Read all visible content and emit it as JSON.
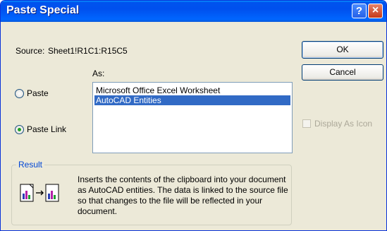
{
  "window": {
    "title": "Paste Special"
  },
  "titlebar": {
    "help_label": "?",
    "close_label": "×"
  },
  "source": {
    "label": "Source:",
    "value": "Sheet1!R1C1:R15C5"
  },
  "as_label": "As:",
  "options": {
    "paste": "Paste",
    "paste_link": "Paste Link",
    "selected": "Paste Link"
  },
  "list": {
    "items": [
      "Microsoft Office Excel Worksheet",
      "AutoCAD Entities"
    ],
    "selected": "AutoCAD Entities"
  },
  "buttons": {
    "ok": "OK",
    "cancel": "Cancel"
  },
  "display_as_icon": {
    "label": "Display As Icon",
    "checked": false,
    "enabled": false
  },
  "result": {
    "label": "Result",
    "text": "Inserts the contents of the clipboard into your document as AutoCAD entities.  The data is linked to the source file so that changes to the file will be reflected in your document."
  },
  "colors": {
    "titlebar": "#0054e3",
    "selection": "#316ac5",
    "dialog_bg": "#ece9d8"
  }
}
